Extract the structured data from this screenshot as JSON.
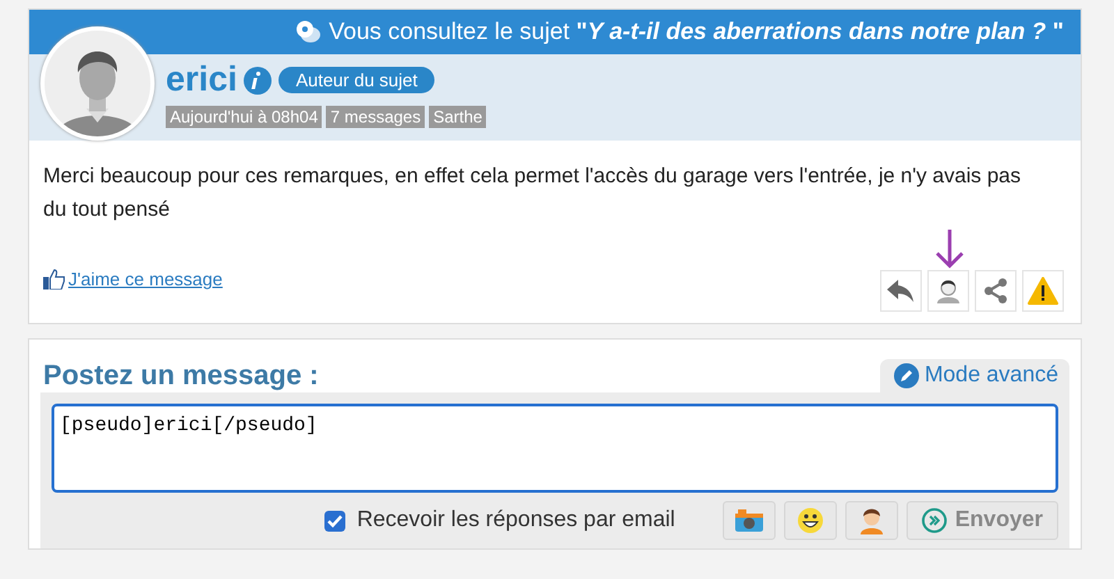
{
  "topic_bar": {
    "text": "Vous consultez le sujet **\"*Y a-t-il des aberrations dans notre plan ?* \"**"
  },
  "post": {
    "author": "erici",
    "badge": "Auteur du sujet",
    "meta": [
      "Aujourd'hui à 08h04",
      "7 messages",
      "Sarthe"
    ],
    "body": "Merci beaucoup pour ces remarques, en effet cela permet l'accès du garage vers l'entrée, je n'y avais pas du tout pensé",
    "like": "J'aime ce message",
    "actions": [
      {
        "kind": "reply"
      },
      {
        "kind": "profile",
        "annotated": true
      },
      {
        "kind": "share"
      },
      {
        "kind": "report"
      }
    ]
  },
  "compose": {
    "title": "Postez un message :",
    "mode_tab": "Mode avancé",
    "value": "[pseudo]erici[/pseudo] ",
    "subscribe": {
      "label": "Recevoir les réponses par email",
      "checked": true
    },
    "tools": [
      {
        "kind": "camera"
      },
      {
        "kind": "smiley"
      },
      {
        "kind": "avatar"
      }
    ],
    "submit": "Envoyer"
  }
}
